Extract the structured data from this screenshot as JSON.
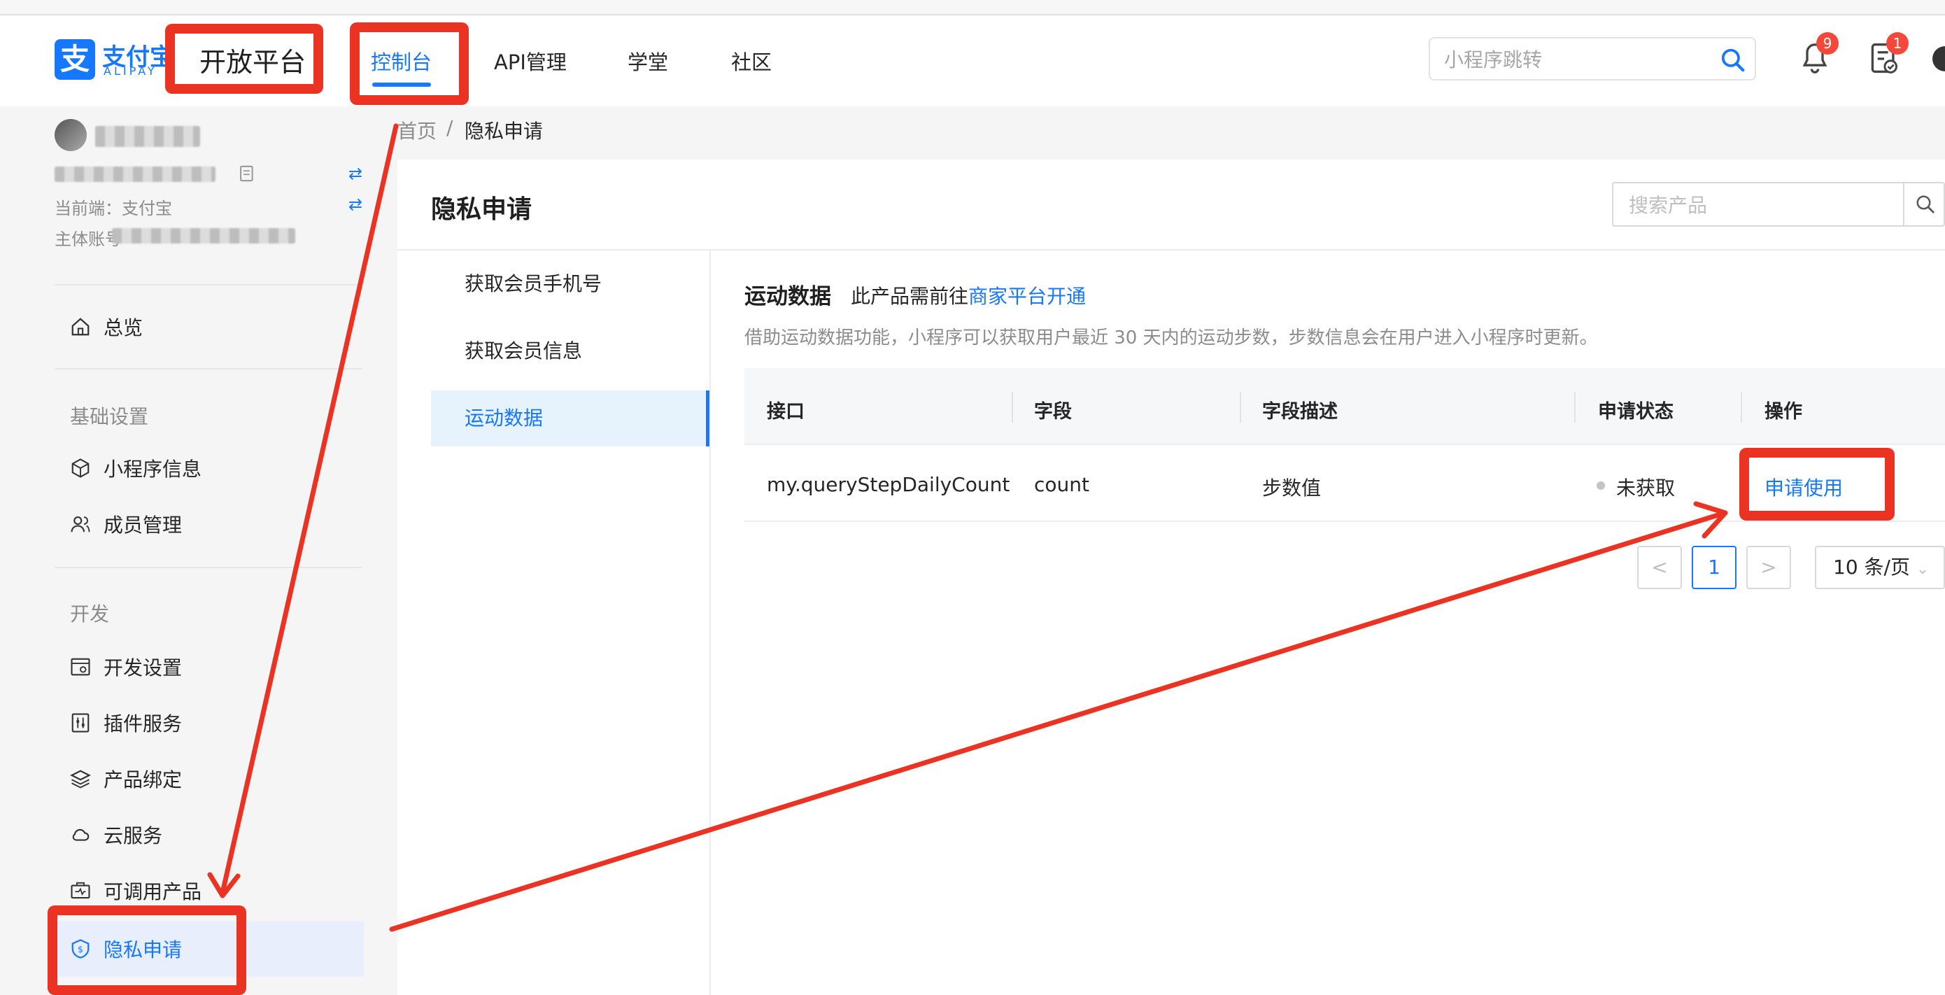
{
  "header": {
    "logo_cn": "支付宝",
    "logo_en": "ALIPAY",
    "platform_title": "开放平台",
    "nav": [
      "控制台",
      "API管理",
      "学堂",
      "社区"
    ],
    "search_placeholder": "小程序跳转",
    "notification_count": "9",
    "todo_count": "1"
  },
  "sidebar": {
    "current_side": "当前端：支付宝",
    "entity_label": "主体账号",
    "overview": "总览",
    "groups": [
      {
        "title": "基础设置",
        "items": [
          "小程序信息",
          "成员管理"
        ]
      },
      {
        "title": "开发",
        "items": [
          "开发设置",
          "插件服务",
          "产品绑定",
          "云服务",
          "可调用产品",
          "隐私申请"
        ]
      }
    ]
  },
  "breadcrumb": {
    "home": "首页",
    "separator": "/",
    "current": "隐私申请"
  },
  "panel": {
    "title": "隐私申请",
    "search_placeholder": "搜索产品",
    "products": [
      "获取会员手机号",
      "获取会员信息",
      "运动数据"
    ],
    "active_product": "运动数据",
    "section": {
      "title": "运动数据",
      "note": "此产品需前往",
      "link": "商家平台开通",
      "description": "借助运动数据功能，小程序可以获取用户最近 30 天内的运动步数，步数信息会在用户进入小程序时更新。"
    },
    "table": {
      "headers": [
        "接口",
        "字段",
        "字段描述",
        "申请状态",
        "操作"
      ],
      "rows": [
        {
          "api": "my.queryStepDailyCount",
          "field": "count",
          "desc": "步数值",
          "status": "未获取",
          "action": "申请使用"
        }
      ]
    },
    "pagination": {
      "prev": "<",
      "current": "1",
      "next": ">",
      "page_size": "10 条/页"
    }
  },
  "colors": {
    "accent": "#1677ff",
    "annotation": "#ea3323",
    "badge": "#f5483b"
  }
}
